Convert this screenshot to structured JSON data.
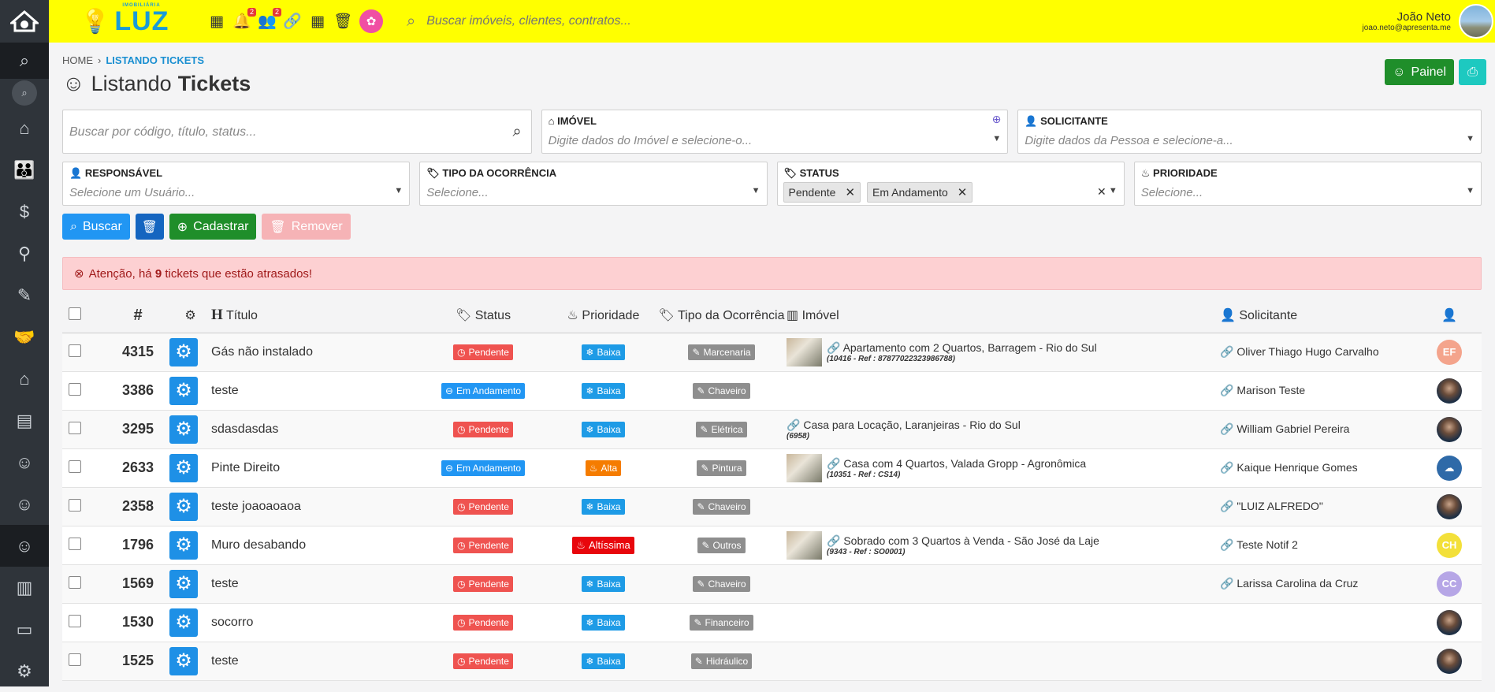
{
  "brand": {
    "name": "LUZ",
    "small": "IMOBILIÁRIA"
  },
  "topbar": {
    "search_placeholder": "Buscar imóveis, clientes, contratos...",
    "quick": [
      {
        "icon": "grid-icon",
        "glyph": "▦",
        "badge": ""
      },
      {
        "icon": "bell-icon",
        "glyph": "🔔",
        "badge": "2"
      },
      {
        "icon": "users-icon",
        "glyph": "👥",
        "badge": "2"
      },
      {
        "icon": "link-icon",
        "glyph": "🔗",
        "badge": ""
      },
      {
        "icon": "calendar-icon",
        "glyph": "📅",
        "badge": ""
      },
      {
        "icon": "trash-icon",
        "glyph": "🗑",
        "badge": ""
      }
    ],
    "user_name": "João Neto",
    "user_email": "joao.neto@apresenta.me"
  },
  "breadcrumb": {
    "home": "HOME",
    "current": "LISTANDO TICKETS"
  },
  "page": {
    "title_light": "Listando",
    "title_bold": "Tickets",
    "painel_label": "Painel"
  },
  "filters": {
    "search_placeholder": "Buscar por código, título, status...",
    "imovel": {
      "label": "IMÓVEL",
      "placeholder": "Digite dados do Imóvel e selecione-o..."
    },
    "solicitante": {
      "label": "SOLICITANTE",
      "placeholder": "Digite dados da Pessoa e selecione-a..."
    },
    "responsavel": {
      "label": "RESPONSÁVEL",
      "placeholder": "Selecione um Usuário..."
    },
    "tipo": {
      "label": "TIPO DA OCORRÊNCIA",
      "placeholder": "Selecione..."
    },
    "status": {
      "label": "STATUS",
      "tags": [
        "Pendente",
        "Em Andamento"
      ]
    },
    "prioridade": {
      "label": "PRIORIDADE",
      "placeholder": "Selecione..."
    }
  },
  "actions": {
    "buscar": "Buscar",
    "cadastrar": "Cadastrar",
    "remover": "Remover"
  },
  "alert": {
    "prefix": "Atenção, há ",
    "count": "9",
    "suffix": " tickets que estão atrasados!"
  },
  "table": {
    "headers": {
      "num": "#",
      "titulo": "Título",
      "status": "Status",
      "prioridade": "Prioridade",
      "tipo": "Tipo da Ocorrência",
      "imovel": "Imóvel",
      "solicitante": "Solicitante"
    },
    "rows": [
      {
        "id": "4315",
        "title": "Gás não instalado",
        "status": "Pendente",
        "status_kind": "pend",
        "prio": "Baixa",
        "prio_kind": "baixa",
        "tipo": "Marcenaria",
        "imovel": "Apartamento com 2 Quartos, Barragem - Rio do Sul",
        "ref": "(10416 - Ref : 87877022323986788)",
        "thumb": true,
        "sol": "Oliver Thiago Hugo Carvalho",
        "av": "EF",
        "av_color": "#f4a48c"
      },
      {
        "id": "3386",
        "title": "teste",
        "status": "Em Andamento",
        "status_kind": "and",
        "prio": "Baixa",
        "prio_kind": "baixa",
        "tipo": "Chaveiro",
        "imovel": "",
        "ref": "",
        "thumb": false,
        "sol": "Marison Teste",
        "av": "",
        "av_color": ""
      },
      {
        "id": "3295",
        "title": "sdasdasdas",
        "status": "Pendente",
        "status_kind": "pend",
        "prio": "Baixa",
        "prio_kind": "baixa",
        "tipo": "Elétrica",
        "imovel": "Casa para Locação, Laranjeiras - Rio do Sul",
        "ref": "(6958)",
        "thumb": false,
        "sol": "William Gabriel Pereira",
        "av": "",
        "av_color": ""
      },
      {
        "id": "2633",
        "title": "Pinte Direito",
        "status": "Em Andamento",
        "status_kind": "and",
        "prio": "Alta",
        "prio_kind": "alta",
        "tipo": "Pintura",
        "imovel": "Casa com 4 Quartos, Valada Gropp - Agronômica",
        "ref": "(10351 - Ref : CS14)",
        "thumb": true,
        "sol": "Kaique Henrique Gomes",
        "av": "☁",
        "av_color": "#2f6aa8"
      },
      {
        "id": "2358",
        "title": "teste joaoaoaoa",
        "status": "Pendente",
        "status_kind": "pend",
        "prio": "Baixa",
        "prio_kind": "baixa",
        "tipo": "Chaveiro",
        "imovel": "",
        "ref": "",
        "thumb": false,
        "sol": "\"LUIZ ALFREDO\"",
        "av": "",
        "av_color": ""
      },
      {
        "id": "1796",
        "title": "Muro desabando",
        "status": "Pendente",
        "status_kind": "pend",
        "prio": "Altíssima",
        "prio_kind": "altis",
        "tipo": "Outros",
        "imovel": "Sobrado com 3 Quartos à Venda - São José da Laje",
        "ref": "(9343 - Ref : SO0001)",
        "thumb": true,
        "sol": "Teste Notif 2",
        "av": "CH",
        "av_color": "#f3e03a"
      },
      {
        "id": "1569",
        "title": "teste",
        "status": "Pendente",
        "status_kind": "pend",
        "prio": "Baixa",
        "prio_kind": "baixa",
        "tipo": "Chaveiro",
        "imovel": "",
        "ref": "",
        "thumb": false,
        "sol": "Larissa Carolina da Cruz",
        "av": "CC",
        "av_color": "#b6a6e6"
      },
      {
        "id": "1530",
        "title": "socorro",
        "status": "Pendente",
        "status_kind": "pend",
        "prio": "Baixa",
        "prio_kind": "baixa",
        "tipo": "Financeiro",
        "imovel": "",
        "ref": "",
        "thumb": false,
        "sol": "",
        "av": "",
        "av_color": ""
      },
      {
        "id": "1525",
        "title": "teste",
        "status": "Pendente",
        "status_kind": "pend",
        "prio": "Baixa",
        "prio_kind": "baixa",
        "tipo": "Hidráulico",
        "imovel": "",
        "ref": "",
        "thumb": false,
        "sol": "",
        "av": "",
        "av_color": ""
      }
    ]
  }
}
